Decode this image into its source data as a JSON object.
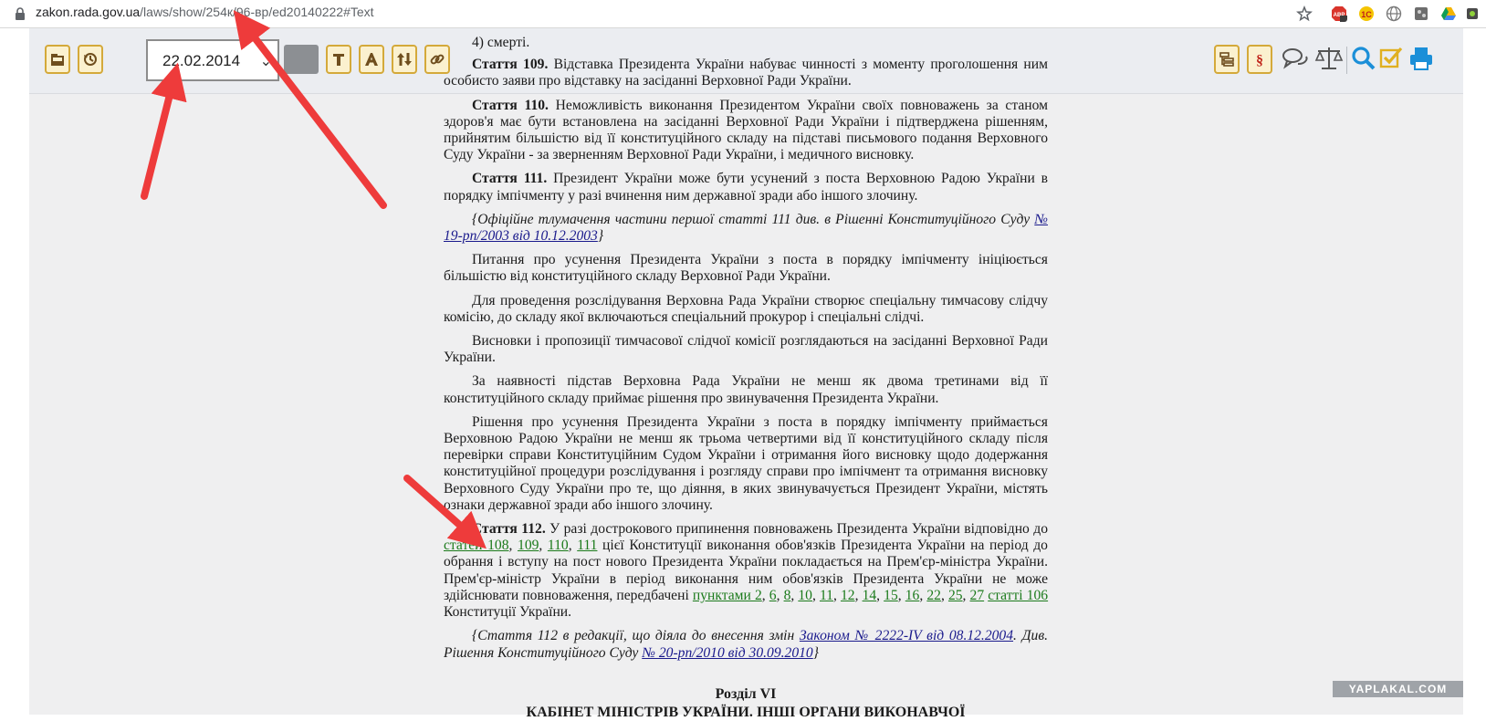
{
  "browser": {
    "url_host": "zakon.rada.gov.ua",
    "url_path": "/laws/show/254к/96-вр/ed20140222#Text"
  },
  "toolbar": {
    "date_value": "22.02.2014",
    "left_icons": [
      "folder-icon",
      "history-icon"
    ],
    "mid_icons": [
      "text-t-icon",
      "text-a-icon",
      "sort-icon",
      "link-icon"
    ],
    "right_icons": [
      "tree-icon",
      "paragraph-icon",
      "comments-icon",
      "scales-icon",
      "search-icon",
      "checkbox-icon",
      "print-icon"
    ],
    "accent": "#d4a93a",
    "right_accent": "#1b8fd8"
  },
  "doc": {
    "p0": "4) смерті.",
    "a109_head": "Стаття 109.",
    "a109_text": " Відставка Президента України набуває чинності з моменту проголошення ним особисто заяви про відставку на засіданні Верховної Ради України.",
    "a110_head": "Стаття 110.",
    "a110_text": " Неможливість виконання Президентом України своїх повноважень за станом здоров'я має бути встановлена на засіданні Верховної Ради України і підтверджена рішенням, прийнятим більшістю від її конституційного складу на підставі письмового подання Верховного Суду України - за зверненням Верховної Ради України, і медичного висновку.",
    "a111_head": "Стаття 111.",
    "a111_text": " Президент України може бути усунений з поста Верховною Радою України в порядку імпічменту у разі вчинення ним державної зради або іншого злочину.",
    "note1_text": "{Офіційне тлумачення частини першої статті 111 див. в Рішенні Конституційного Суду ",
    "note1_link": "№ 19-рп/2003 від 10.12.2003",
    "note1_end": "}",
    "p_init": "Питання про усунення Президента України з поста в порядку імпічменту ініціюється більшістю від конституційного складу Верховної Ради України.",
    "p_invest": "Для проведення розслідування Верховна Рада України створює спеціальну тимчасову слідчу комісію, до складу якої включаються спеціальний прокурор і спеціальні слідчі.",
    "p_concl": "Висновки і пропозиції тимчасової слідчої комісії розглядаються на засіданні Верховної Ради України.",
    "p_charge": "За наявності підстав Верховна Рада України не менш як двома третинами від її конституційного складу приймає рішення про звинувачення Президента України.",
    "p_decision": "Рішення про усунення Президента України з поста в порядку імпічменту приймається Верховною Радою України не менш як трьома четвертими від її конституційного складу після перевірки справи Конституційним Судом України і отримання його висновку щодо додержання конституційної процедури розслідування і розгляду справи про імпічмент та отримання висновку Верховного Суду України про те, що діяння, в яких звинувачується Президент України, містять ознаки державної зради або іншого злочину.",
    "a112_head": "Стаття 112.",
    "a112_t1": " У разі дострокового припинення повноважень Президента України відповідно до ",
    "a112_l_stat": "статей 108",
    "a112_l_109": "109",
    "a112_l_110": "110",
    "a112_l_111": "111",
    "a112_t2": " цієї Конституції виконання обов'язків Президента України на період до обрання і вступу на пост нового Президента України покладається на Прем'єр-міністра України. Прем'єр-міністр України в період виконання ним обов'язків Президента України не може здійснювати повноваження, передбачені ",
    "a112_l_punkt": "пунктами 2",
    "a112_l_6": "6",
    "a112_l_8": "8",
    "a112_l_10": "10",
    "a112_l_11": "11",
    "a112_l_12": "12",
    "a112_l_14": "14",
    "a112_l_15": "15",
    "a112_l_16": "16",
    "a112_l_22": "22",
    "a112_l_25": "25",
    "a112_l_27": "27",
    "a112_l_106": "статті 106",
    "a112_t3": " Конституції України.",
    "note2_t1": "{Стаття 112 в редакції, що діяла до внесення змін ",
    "note2_l1": "Законом № 2222-IV від 08.12.2004",
    "note2_t2": ". Див. Рішення Конституційного Суду ",
    "note2_l2": "№ 20-рп/2010 від 30.09.2010",
    "note2_t3": "}",
    "section_title": "Розділ VI",
    "section_sub": "КАБІНЕТ МІНІСТРІВ УКРАЇНИ. ІНШІ ОРГАНИ ВИКОНАВЧОЇ"
  },
  "watermark": "YAPLAKAL.COM"
}
